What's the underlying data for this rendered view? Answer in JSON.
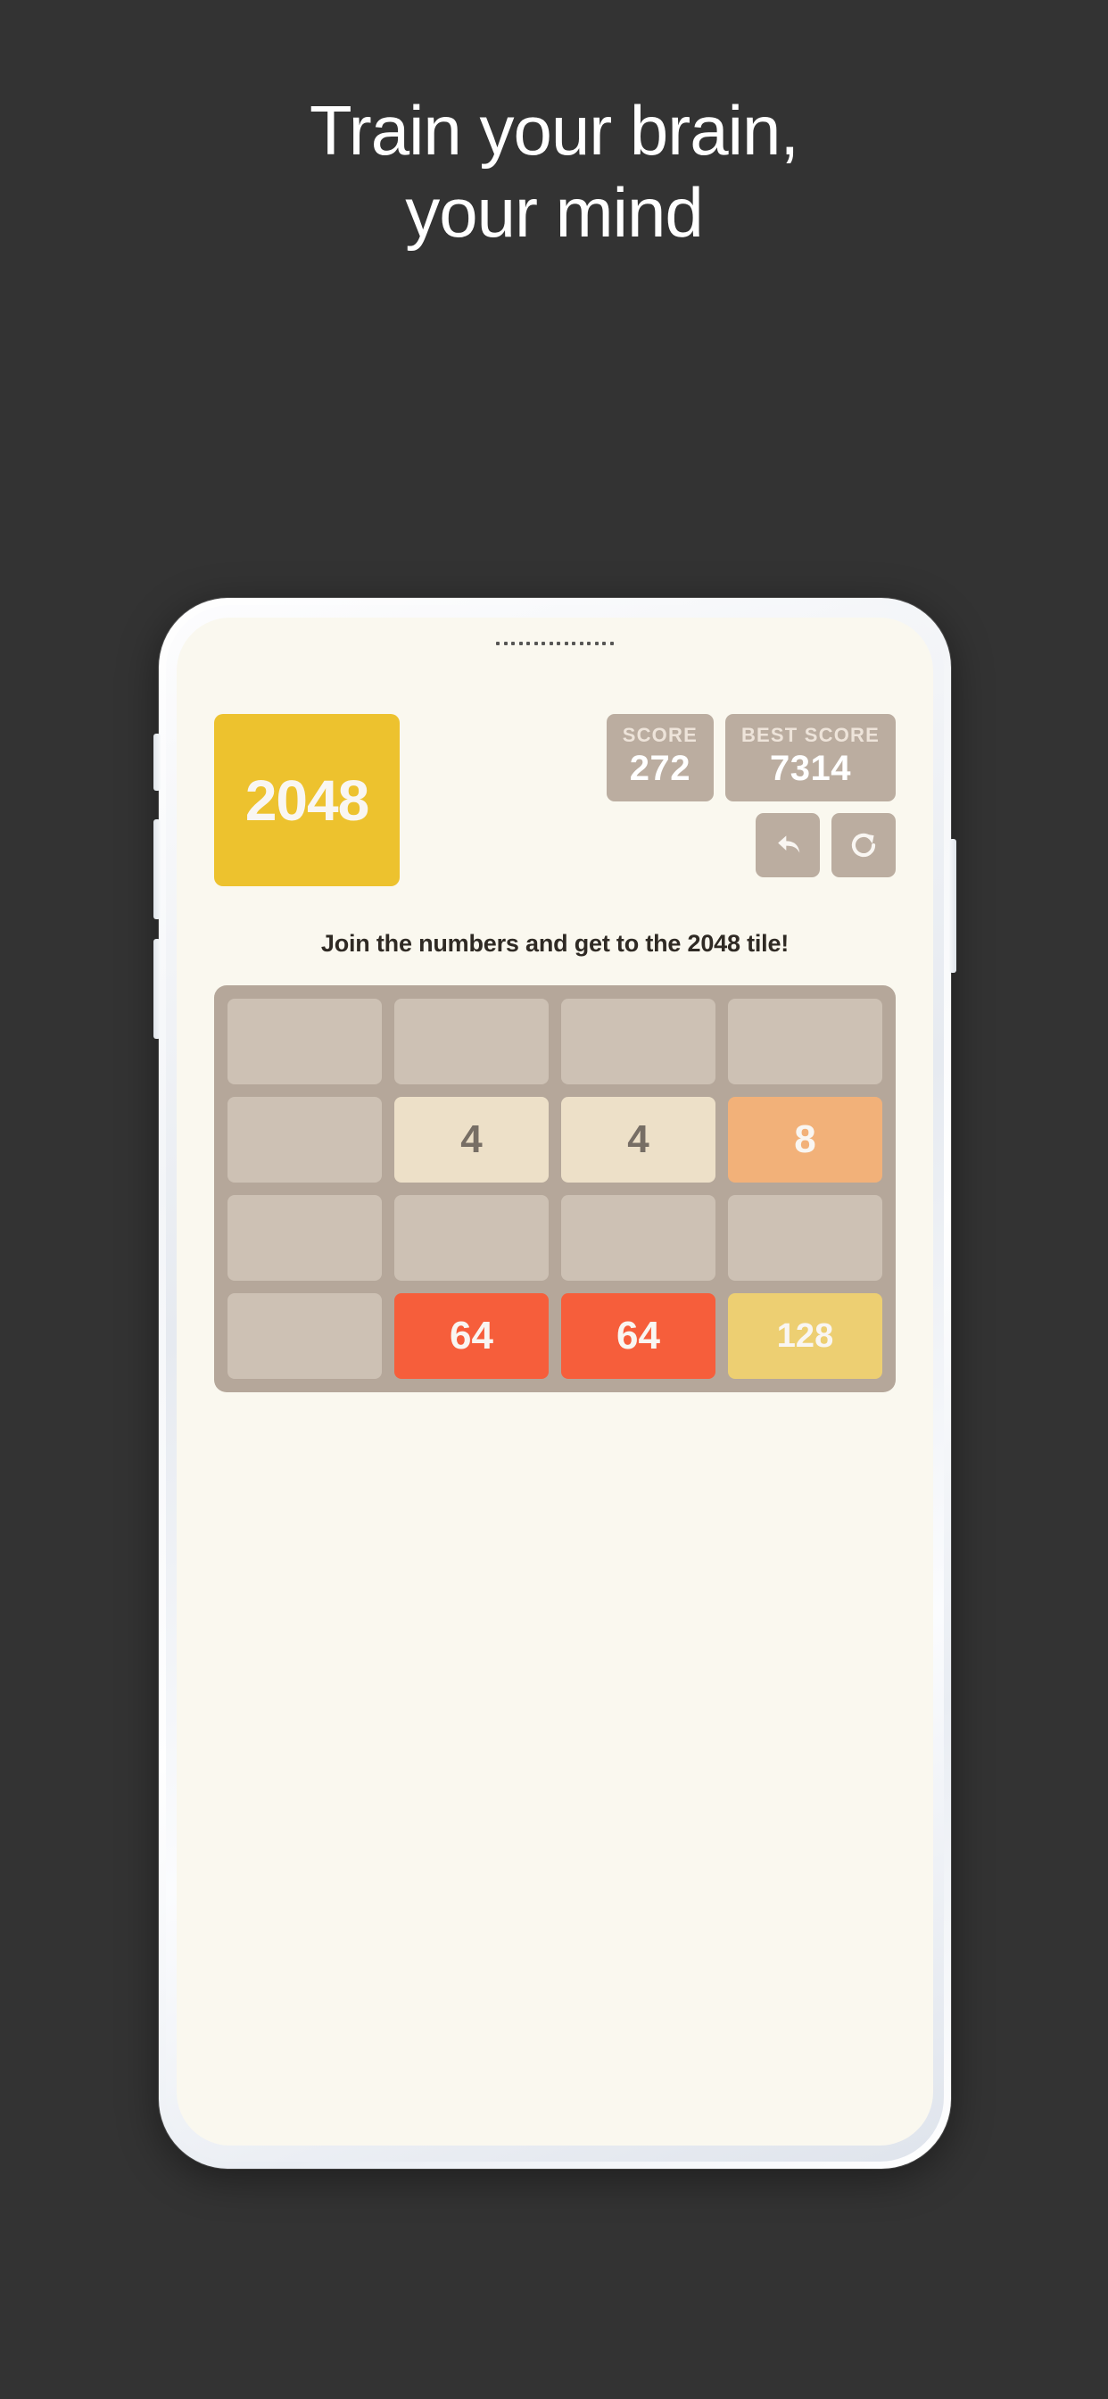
{
  "promo": {
    "headline_line1": "Train your brain,",
    "headline_line2": "your mind",
    "background_color": "#333333",
    "text_color": "#ffffff"
  },
  "app": {
    "logo_label": "2048",
    "logo_color": "#edc22e",
    "screen_background": "#faf8ef",
    "tagline": "Join the numbers and get to the 2048 tile!",
    "score": {
      "label": "SCORE",
      "value": "272"
    },
    "best_score": {
      "label": "BEST SCORE",
      "value": "7314"
    },
    "controls": [
      {
        "name": "undo-button",
        "icon": "undo-arrow-icon"
      },
      {
        "name": "restart-button",
        "icon": "redo-refresh-icon"
      }
    ],
    "board": {
      "background_color": "#b5a79a",
      "empty_cell_color": "#cdc1b4",
      "rows": 4,
      "columns": 4,
      "cells": [
        {
          "value": "",
          "tile": "empty"
        },
        {
          "value": "",
          "tile": "empty"
        },
        {
          "value": "",
          "tile": "empty"
        },
        {
          "value": "",
          "tile": "empty"
        },
        {
          "value": "",
          "tile": "empty"
        },
        {
          "value": "4",
          "tile": "t4"
        },
        {
          "value": "4",
          "tile": "t4"
        },
        {
          "value": "8",
          "tile": "t8"
        },
        {
          "value": "",
          "tile": "empty"
        },
        {
          "value": "",
          "tile": "empty"
        },
        {
          "value": "",
          "tile": "empty"
        },
        {
          "value": "",
          "tile": "empty"
        },
        {
          "value": "",
          "tile": "empty"
        },
        {
          "value": "64",
          "tile": "t64"
        },
        {
          "value": "64",
          "tile": "t64"
        },
        {
          "value": "128",
          "tile": "t128"
        }
      ],
      "tile_colors": {
        "4": "#ede0c8",
        "8": "#f2b179",
        "64": "#f65e3b",
        "128": "#edcf72"
      }
    }
  },
  "device": {
    "frame_color": "#ffffff",
    "hardware_buttons": [
      "silent-switch",
      "volume-up",
      "volume-down",
      "power"
    ]
  }
}
